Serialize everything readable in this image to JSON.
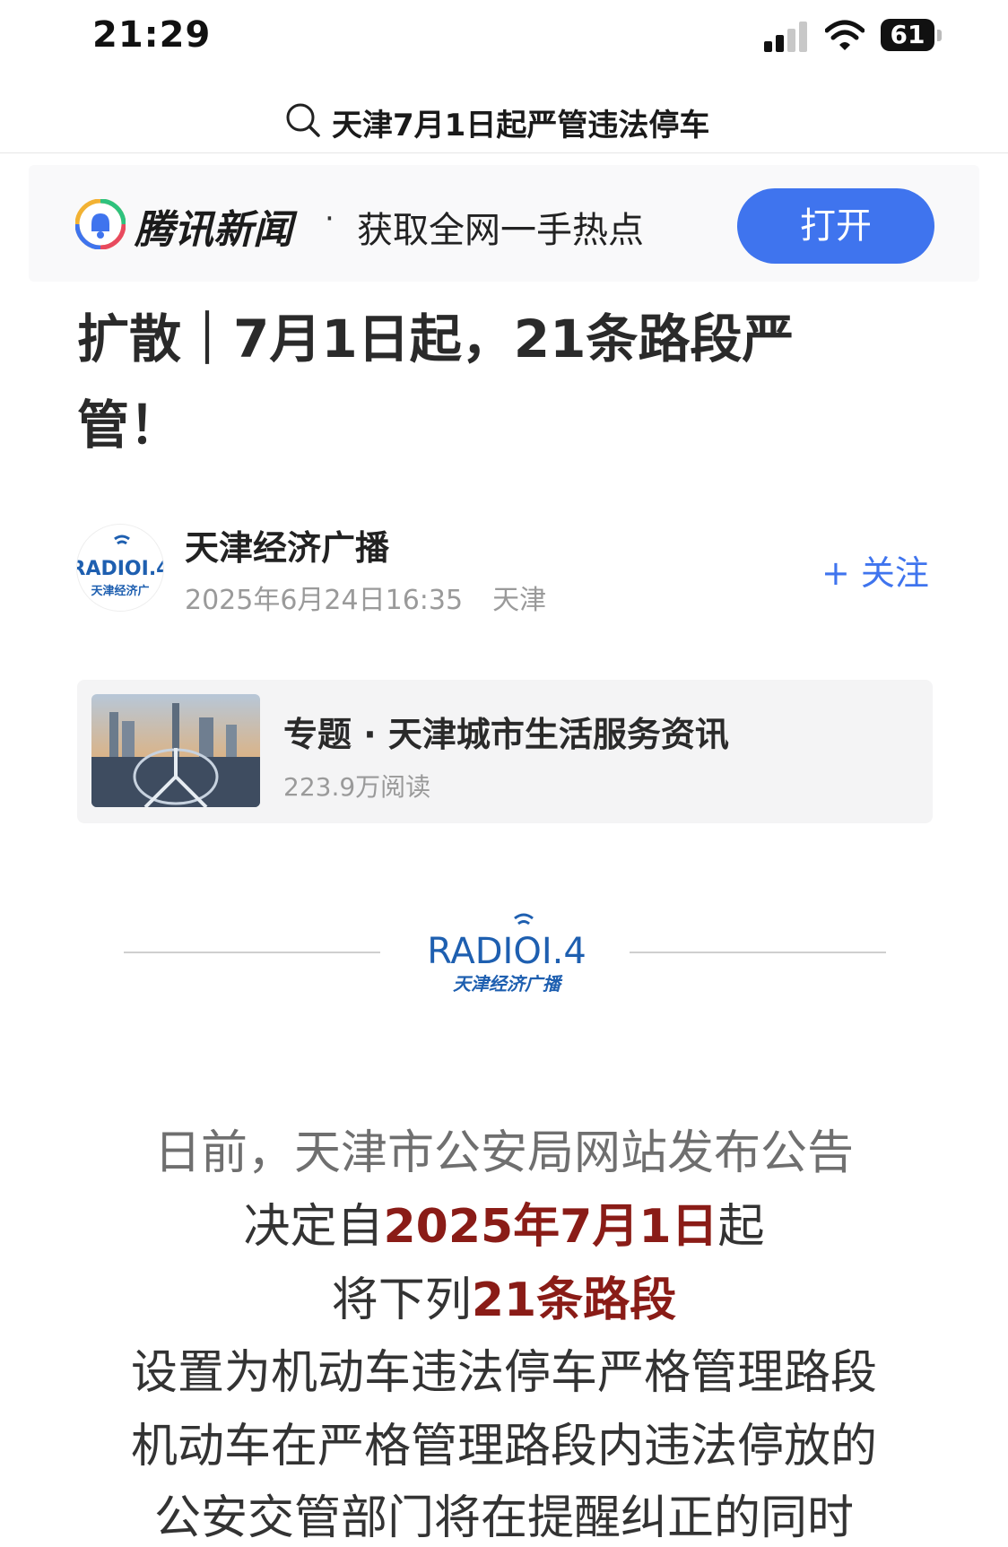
{
  "status_bar": {
    "time": "21:29",
    "battery": "61"
  },
  "search": {
    "query": "天津7月1日起严管违法停车"
  },
  "banner": {
    "app_name": "腾讯新闻",
    "separator": "·",
    "slogan": "获取全网一手热点",
    "open_label": "打开"
  },
  "article": {
    "title_line1": "扩散｜7月1日起，21条路段严",
    "title_line2": "管！"
  },
  "author": {
    "name": "天津经济广播",
    "datetime": "2025年6月24日16:35",
    "location": "天津",
    "follow_label": "+ 关注",
    "avatar_text_top": "RADIOI.4",
    "avatar_text_bottom": "天津经济广"
  },
  "topic": {
    "label": "专题 · 天津城市生活服务资讯",
    "reads": "223.9万阅读"
  },
  "radio_logo": {
    "brand": "RADIOI.4",
    "subtitle": "天津经济广播"
  },
  "body": {
    "line1": "日前，天津市公安局网站发布公告",
    "line2_pre": "决定自",
    "line2_hl": "2025年7月1日",
    "line2_post": "起",
    "line3_pre": "将下列",
    "line3_hl": "21条路段",
    "line4": "设置为机动车违法停车严格管理路段",
    "line5": "机动车在严格管理路段内违法停放的",
    "line6": "公安交管部门将在提醒纠正的同时"
  },
  "colors": {
    "accent_blue": "#3f74ee",
    "highlight_red": "#8a1c17"
  }
}
